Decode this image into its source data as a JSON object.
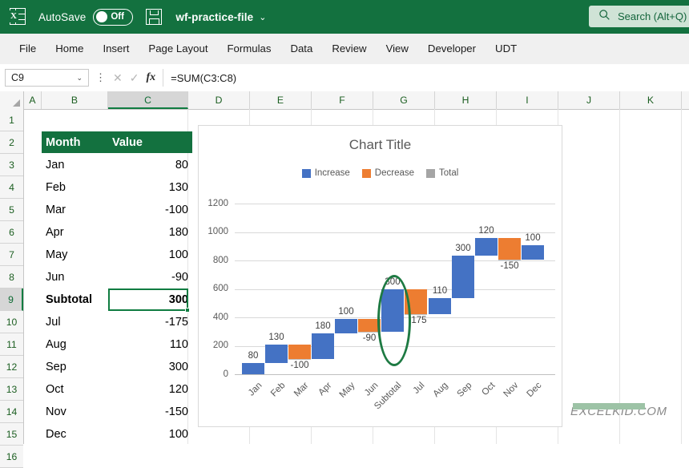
{
  "titlebar": {
    "logo_icon": "excel-logo-icon",
    "autosave_label": "AutoSave",
    "autosave_state": "Off",
    "save_icon": "save-icon",
    "filename": "wf-practice-file",
    "filename_chevron": "⌄",
    "search_icon": "search-icon",
    "search_placeholder": "Search (Alt+Q)",
    "bg_color": "#13713f"
  },
  "ribbon": {
    "tabs": [
      "File",
      "Home",
      "Insert",
      "Page Layout",
      "Formulas",
      "Data",
      "Review",
      "View",
      "Developer",
      "UDT"
    ]
  },
  "formula_bar": {
    "name_box_value": "C9",
    "name_box_chevron": "⌄",
    "cancel_icon": "cancel-x-icon",
    "enter_icon": "enter-check-icon",
    "function_icon": "fx-icon",
    "formula_value": "=SUM(C3:C8)"
  },
  "grid": {
    "column_headers": [
      "A",
      "B",
      "C",
      "D",
      "E",
      "F",
      "G",
      "H",
      "I",
      "J",
      "K"
    ],
    "selected_column": "C",
    "row_headers": [
      "1",
      "2",
      "3",
      "4",
      "5",
      "6",
      "7",
      "8",
      "9",
      "10",
      "11",
      "12",
      "13",
      "14",
      "15",
      "16"
    ],
    "selected_row": "9",
    "active_cell": "C9",
    "table_header": {
      "month": "Month",
      "value": "Value",
      "fill": "#13713f",
      "text": "#ffffff"
    },
    "rows": [
      {
        "row": "3",
        "month": "Jan",
        "value": "80",
        "bold": false
      },
      {
        "row": "4",
        "month": "Feb",
        "value": "130",
        "bold": false
      },
      {
        "row": "5",
        "month": "Mar",
        "value": "-100",
        "bold": false
      },
      {
        "row": "6",
        "month": "Apr",
        "value": "180",
        "bold": false
      },
      {
        "row": "7",
        "month": "May",
        "value": "100",
        "bold": false
      },
      {
        "row": "8",
        "month": "Jun",
        "value": "-90",
        "bold": false
      },
      {
        "row": "9",
        "month": "Subtotal",
        "value": "300",
        "bold": true
      },
      {
        "row": "10",
        "month": "Jul",
        "value": "-175",
        "bold": false
      },
      {
        "row": "11",
        "month": "Aug",
        "value": "110",
        "bold": false
      },
      {
        "row": "12",
        "month": "Sep",
        "value": "300",
        "bold": false
      },
      {
        "row": "13",
        "month": "Oct",
        "value": "120",
        "bold": false
      },
      {
        "row": "14",
        "month": "Nov",
        "value": "-150",
        "bold": false
      },
      {
        "row": "15",
        "month": "Dec",
        "value": "100",
        "bold": false
      }
    ]
  },
  "chart_data": {
    "type": "bar",
    "subtype": "waterfall",
    "title": "Chart Title",
    "xlabel": "",
    "ylabel": "",
    "ylim": [
      0,
      1200
    ],
    "yticks": [
      0,
      200,
      400,
      600,
      800,
      1000,
      1200
    ],
    "grid": true,
    "legend_position": "top",
    "legend": [
      {
        "name": "Increase",
        "color": "#4472C4"
      },
      {
        "name": "Decrease",
        "color": "#ED7D31"
      },
      {
        "name": "Total",
        "color": "#A5A5A5"
      }
    ],
    "categories": [
      "Jan",
      "Feb",
      "Mar",
      "Apr",
      "May",
      "Jun",
      "Subtotal",
      "Jul",
      "Aug",
      "Sep",
      "Oct",
      "Nov",
      "Dec"
    ],
    "values": [
      80,
      130,
      -100,
      180,
      100,
      -90,
      300,
      -175,
      110,
      300,
      120,
      -150,
      100
    ],
    "labels": [
      "80",
      "130",
      "-100",
      "180",
      "100",
      "-90",
      "300",
      "-175",
      "110",
      "300",
      "120",
      "-150",
      "100"
    ],
    "cumulative_start": [
      0,
      80,
      210,
      110,
      290,
      390,
      300,
      600,
      425,
      535,
      835,
      955,
      805
    ],
    "cumulative_end": [
      80,
      210,
      110,
      290,
      390,
      300,
      600,
      425,
      535,
      835,
      955,
      805,
      905
    ],
    "bar_types": [
      "increase",
      "increase",
      "decrease",
      "increase",
      "increase",
      "decrease",
      "increase",
      "decrease",
      "increase",
      "increase",
      "increase",
      "decrease",
      "increase"
    ],
    "annotation": {
      "shape": "ellipse",
      "target_category": "Subtotal",
      "color": "#1e7a43"
    }
  },
  "watermark": {
    "text": "EXCELKID.COM",
    "bar_color": "#9dc3a6"
  }
}
